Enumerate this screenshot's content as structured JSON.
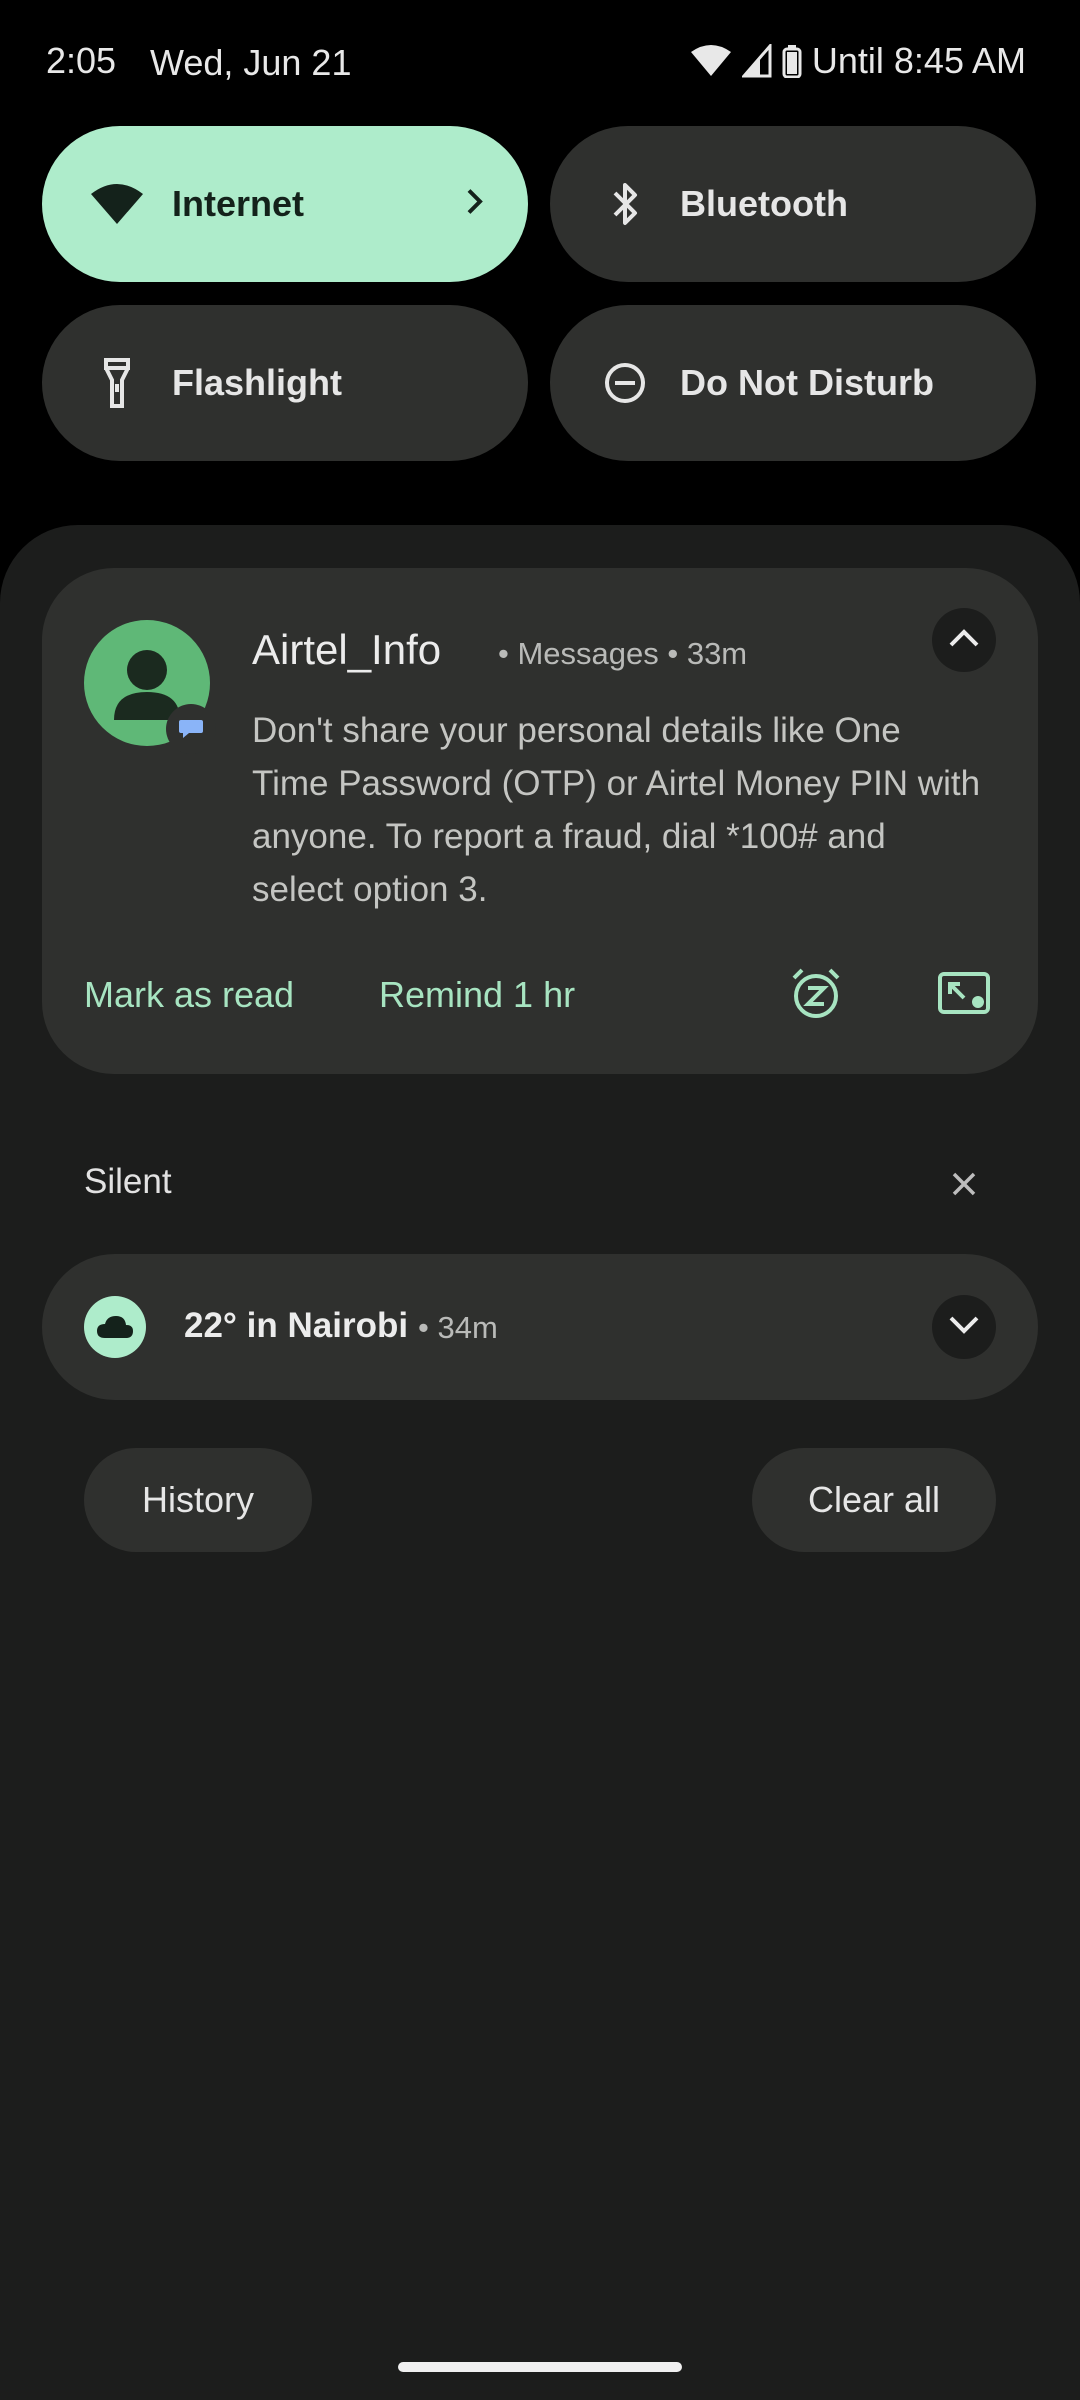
{
  "status_bar": {
    "time": "2:05",
    "date": "Wed, Jun 21",
    "battery_text": "Until 8:45 AM"
  },
  "quick_settings": {
    "tiles": [
      {
        "label": "Internet",
        "icon": "wifi-icon",
        "active": true
      },
      {
        "label": "Bluetooth",
        "icon": "bluetooth-icon",
        "active": false
      },
      {
        "label": "Flashlight",
        "icon": "flashlight-icon",
        "active": false
      },
      {
        "label": "Do Not Disturb",
        "icon": "do-not-disturb-icon",
        "active": false
      }
    ]
  },
  "notification": {
    "title": "Airtel_Info",
    "meta": "• Messages • 33m",
    "body": "Don't share your personal details like One Time Password (OTP) or Airtel Money PIN with anyone. To report a fraud, dial *100# and select option 3.",
    "actions": {
      "mark_read": "Mark as read",
      "remind": "Remind 1 hr"
    }
  },
  "silent_section": {
    "label": "Silent"
  },
  "weather_notification": {
    "title": "22° in Nairobi",
    "meta": "• 34m"
  },
  "footer_buttons": {
    "history": "History",
    "clear_all": "Clear all"
  },
  "colors": {
    "accent": "#aeeccb",
    "action_text": "#a7e4c1",
    "surface": "#2f302e",
    "shade_bg": "#1c1d1c"
  }
}
